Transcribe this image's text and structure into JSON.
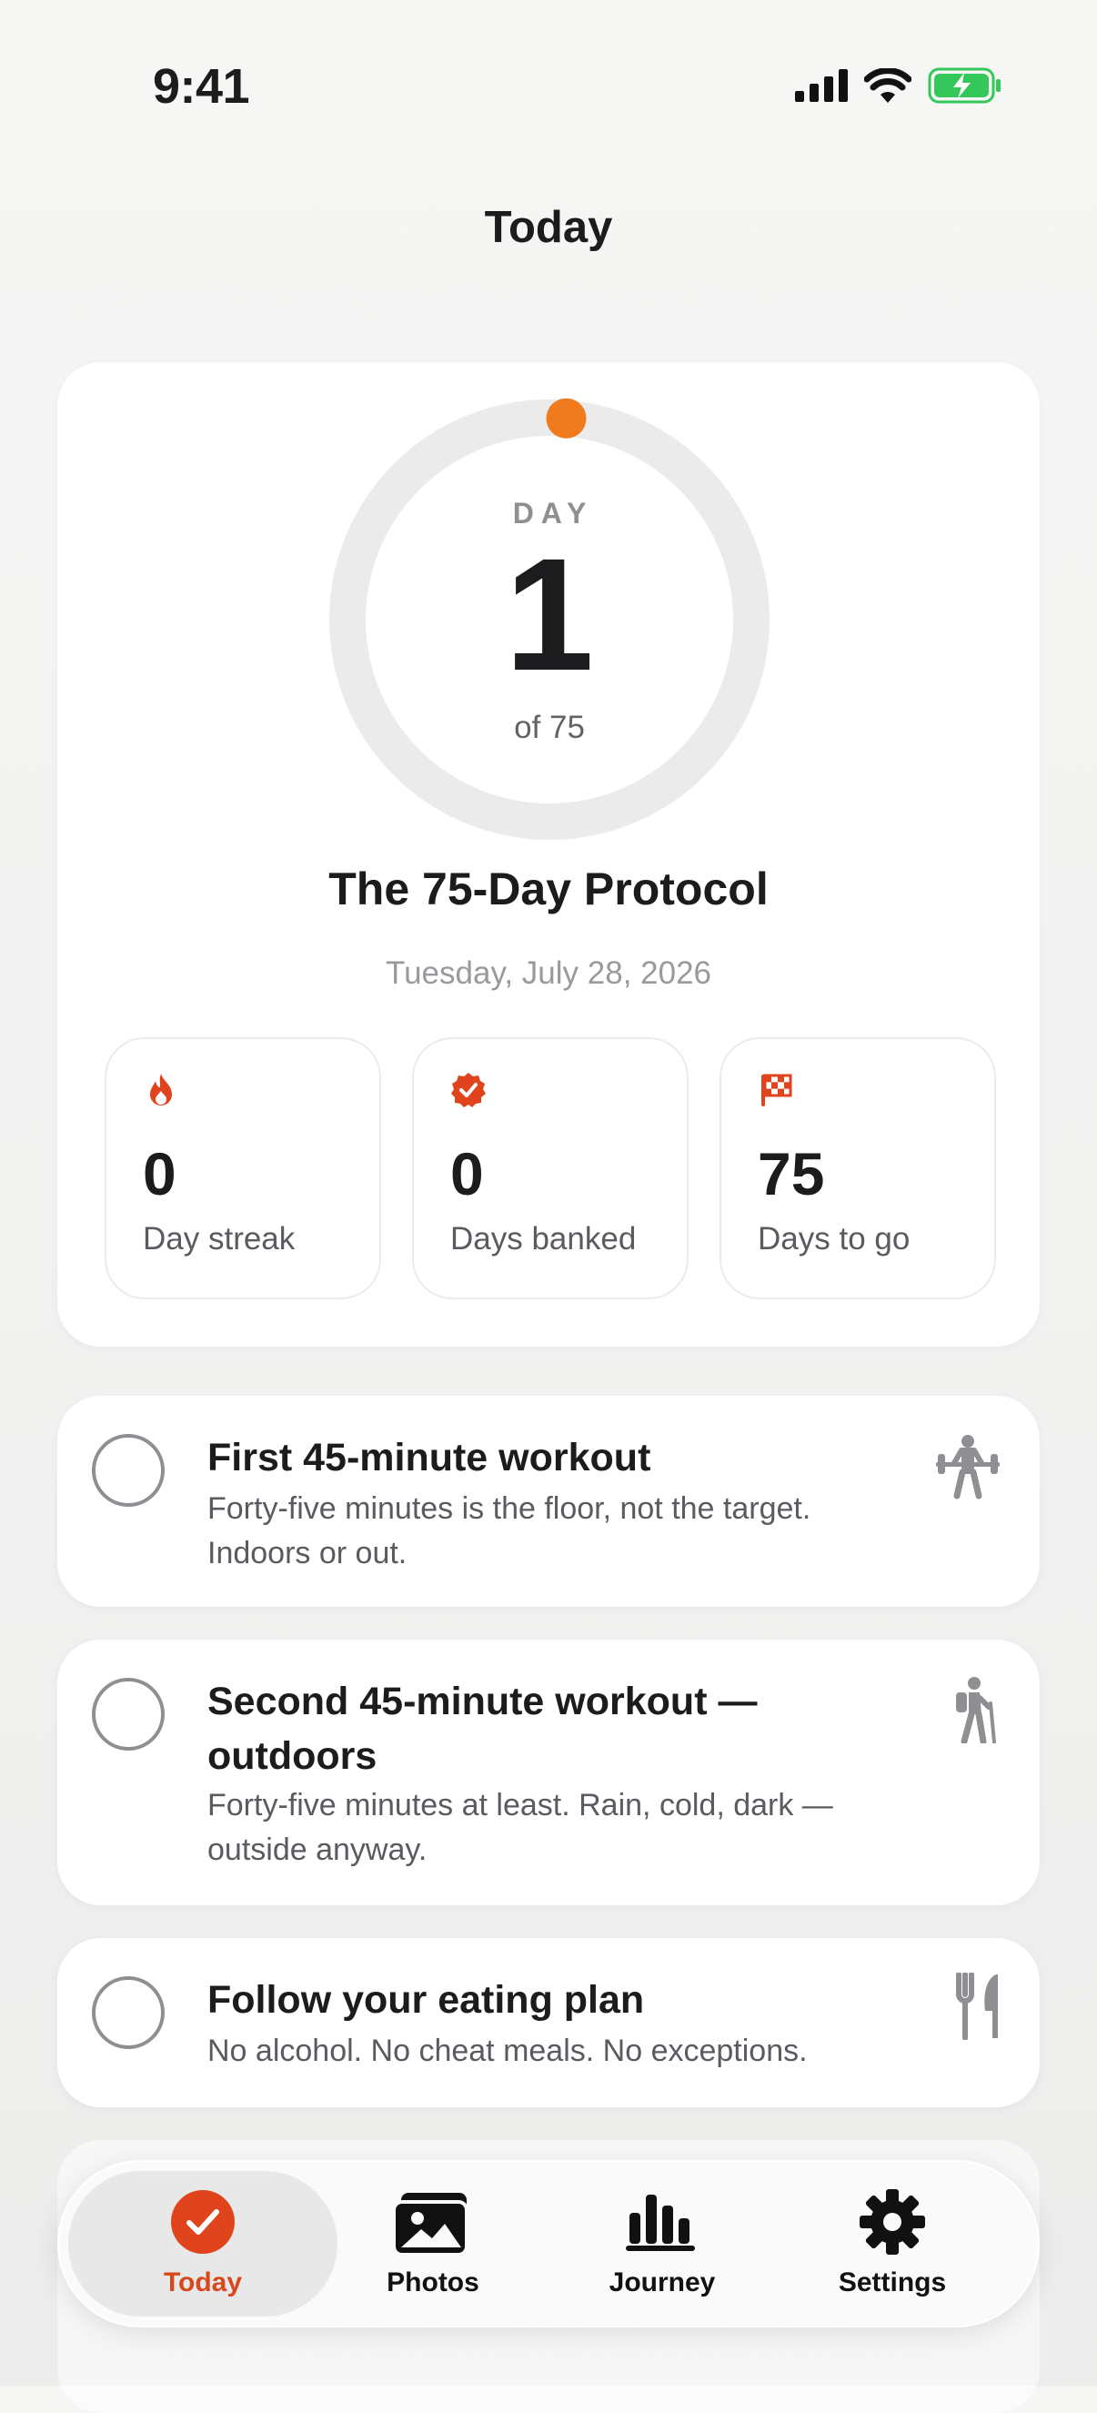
{
  "status_bar": {
    "time": "9:41"
  },
  "nav": {
    "title": "Today"
  },
  "progress": {
    "day_label": "DAY",
    "day_number": "1",
    "day_of": "of 75",
    "fraction_complete": 0.0133
  },
  "program": {
    "title": "The 75-Day Protocol",
    "date": "Tuesday, July 28, 2026"
  },
  "stats": [
    {
      "icon": "flame-icon",
      "value": "0",
      "label": "Day streak"
    },
    {
      "icon": "verified-badge-icon",
      "value": "0",
      "label": "Days banked"
    },
    {
      "icon": "checkered-flag-icon",
      "value": "75",
      "label": "Days to go"
    }
  ],
  "tasks": [
    {
      "title": "First 45-minute workout",
      "description": "Forty-five minutes is the floor, not the target. Indoors or out.",
      "icon": "weightlifter-icon",
      "completed": false
    },
    {
      "title": "Second 45-minute workout — outdoors",
      "description": "Forty-five minutes at least. Rain, cold, dark — outside anyway.",
      "icon": "hiker-icon",
      "completed": false
    },
    {
      "title": "Follow your eating plan",
      "description": "No alcohol. No cheat meals. No exceptions.",
      "icon": "fork-knife-icon",
      "completed": false
    }
  ],
  "tab_bar": {
    "items": [
      {
        "label": "Today",
        "icon": "checkmark-circle-icon",
        "active": true
      },
      {
        "label": "Photos",
        "icon": "photos-stack-icon",
        "active": false
      },
      {
        "label": "Journey",
        "icon": "bar-chart-icon",
        "active": false
      },
      {
        "label": "Settings",
        "icon": "gear-icon",
        "active": false
      }
    ]
  },
  "colors": {
    "accent": "#f07a1e",
    "badge_red": "#e0441c",
    "ring_track": "#ebebec",
    "battery_green": "#34c759"
  }
}
